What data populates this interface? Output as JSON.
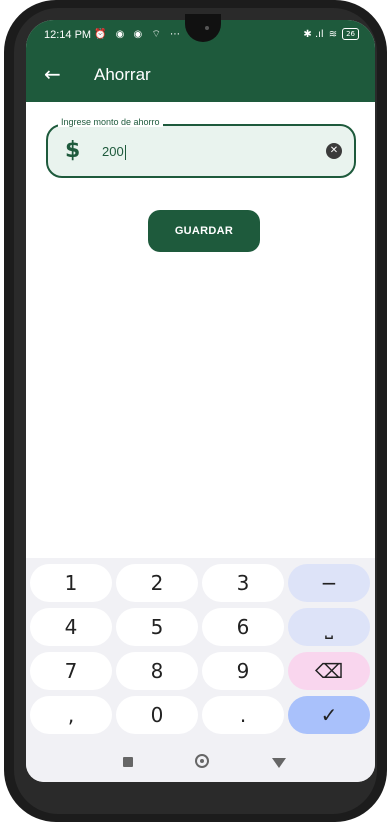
{
  "status_bar": {
    "time": "12:14 PM",
    "left_icons": "⏰ ◉ ◉ ⌔ ⋯",
    "signal": "✱ .ıl",
    "wifi": "≋",
    "battery": "26"
  },
  "appbar": {
    "back_icon": "←",
    "title": "Ahorrar"
  },
  "savings_field": {
    "label": "Ingrese monto de ahorro",
    "prefix_icon": "$",
    "value": "200",
    "clear_icon": "✕"
  },
  "save_button": {
    "label": "GUARDAR"
  },
  "keyboard": {
    "keys": [
      {
        "label": "1"
      },
      {
        "label": "2"
      },
      {
        "label": "3"
      },
      {
        "label": "−"
      },
      {
        "label": "4"
      },
      {
        "label": "5"
      },
      {
        "label": "6"
      },
      {
        "label": "⎵"
      },
      {
        "label": "7"
      },
      {
        "label": "8"
      },
      {
        "label": "9"
      },
      {
        "label": "⌫"
      },
      {
        "label": ","
      },
      {
        "label": "0"
      },
      {
        "label": "."
      },
      {
        "label": "✓"
      }
    ]
  },
  "colors": {
    "primary": "#1e5a3c",
    "field_bg": "#e9f3ee",
    "keyboard_bg": "#f1f1f5",
    "fn_key": "#dde3f8",
    "delete_key": "#f9d6ee",
    "enter_key": "#a9c1fb"
  }
}
